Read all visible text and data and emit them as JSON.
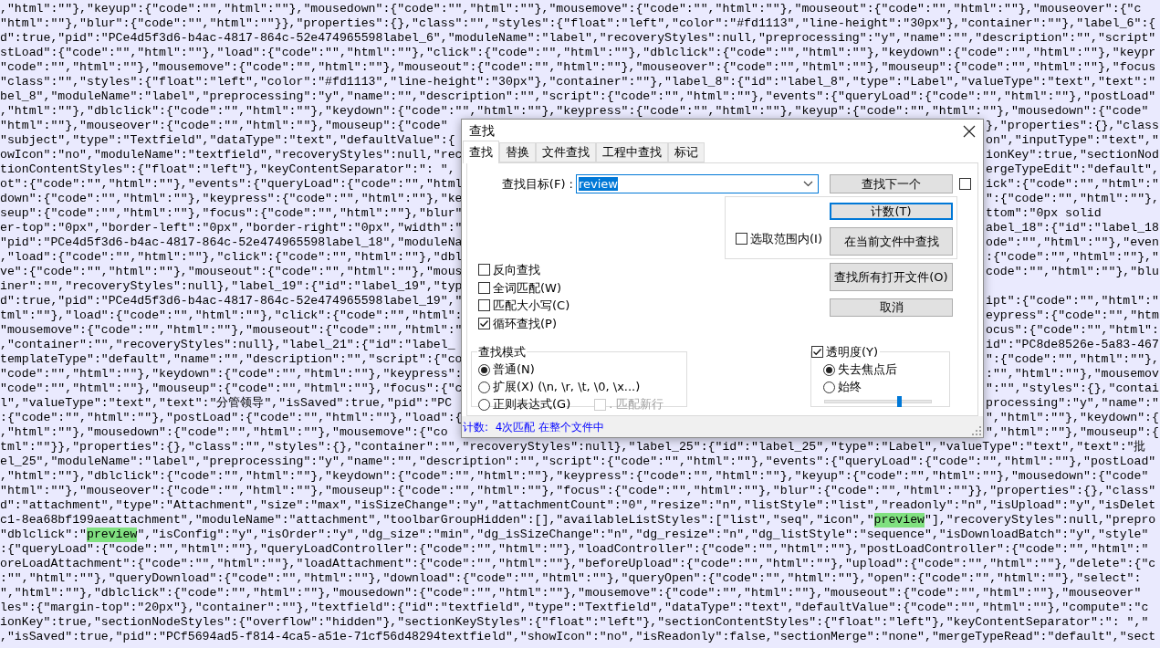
{
  "editor": {
    "lines": [
      {
        "runs": [
          {
            "text": ",\"html\":\"\"},\"keyup\":{\"code\":\"\",\"html\":\"\"},\"mousedown\":{\"code\":\"\",\"html\":\"\"},\"mousemove\":{\"code\":\"\",\"html\":\"\"},\"mouseout\":{\"code\":\"\",\"html\":\"\"},\"mouseover\":{\"c",
            "match": false
          }
        ]
      },
      {
        "runs": [
          {
            "text": "\"html\":\"\"},\"blur\":{\"code\":\"\",\"html\":\"\"}},\"properties\":{},\"class\":\"\",\"styles\":{\"float\":\"left\",\"color\":\"#fd1113\",\"line-height\":\"30px\"},\"container\":\"\"},\"label_6\":{",
            "match": false
          }
        ]
      },
      {
        "runs": [
          {
            "text": "d\":true,\"pid\":\"PCe4d5f3d6-b4ac-4817-864c-52e474965598label_6\",\"moduleName\":\"label\",\"recoveryStyles\":null,\"preprocessing\":\"y\",\"name\":\"\",\"description\":\"\",\"script\"",
            "match": false
          }
        ]
      },
      {
        "runs": [
          {
            "text": "stLoad\":{\"code\":\"\",\"html\":\"\"},\"load\":{\"code\":\"\",\"html\":\"\"},\"click\":{\"code\":\"\",\"html\":\"\"},\"dblclick\":{\"code\":\"\",\"html\":\"\"},\"keydown\":{\"code\":\"\",\"html\":\"\"},\"keypr",
            "match": false
          }
        ]
      },
      {
        "runs": [
          {
            "text": "\"code\":\"\",\"html\":\"\"},\"mousemove\":{\"code\":\"\",\"html\":\"\"},\"mouseout\":{\"code\":\"\",\"html\":\"\"},\"mouseover\":{\"code\":\"\",\"html\":\"\"},\"mouseup\":{\"code\":\"\",\"html\":\"\"},\"focus",
            "match": false
          }
        ]
      },
      {
        "runs": [
          {
            "text": "\"class\":\"\",\"styles\":{\"float\":\"left\",\"color\":\"#fd1113\",\"line-height\":\"30px\"},\"container\":\"\"},\"label_8\":{\"id\":\"label_8\",\"type\":\"Label\",\"valueType\":\"text\",\"text\":\"",
            "match": false
          }
        ]
      },
      {
        "runs": [
          {
            "text": "bel_8\",\"moduleName\":\"label\",\"preprocessing\":\"y\",\"name\":\"\",\"description\":\"\",\"script\":{\"code\":\"\",\"html\":\"\"},\"events\":{\"queryLoad\":{\"code\":\"\",\"html\":\"\"},\"postLoad\"",
            "match": false
          }
        ]
      },
      {
        "runs": [
          {
            "text": ",\"html\":\"\"},\"dblclick\":{\"code\":\"\",\"html\":\"\"},\"keydown\":{\"code\":\"\",\"html\":\"\"},\"keypress\":{\"code\":\"\",\"html\":\"\"},\"keyup\":{\"code\":\"\",\"html\":\"\"},\"mousedown\":{\"code\"",
            "match": false
          }
        ]
      },
      {
        "runs": [
          {
            "text": "\"html\":\"\"},\"mouseover\":{\"code\":\"\",\"html\":\"\"},\"mouseup\":{\"code\"",
            "match": false
          }
        ],
        "right": "},\"properties\":{},\"class"
      },
      {
        "runs": [
          {
            "text": "\"subject\",\"type\":\"Textfield\",\"dataType\":\"text\",\"defaultValue\":{",
            "match": false
          }
        ],
        "right": "on\",\"inputType\":\"text\",\""
      },
      {
        "runs": [
          {
            "text": "owIcon\":\"no\",\"moduleName\":\"textfield\",\"recoveryStyles\":null,\"rec",
            "match": false
          }
        ],
        "right": "ionKey\":true,\"sectionNod"
      },
      {
        "runs": [
          {
            "text": "tionContentStyles\":{\"float\":\"left\"},\"keyContentSeparator\":\": \",",
            "match": false
          }
        ],
        "right": "ergeTypeEdit\":\"default\","
      },
      {
        "runs": [
          {
            "text": "ot\":{\"code\":\"\",\"html\":\"\"},\"events\":{\"queryLoad\":{\"code\":\"\",\"html",
            "match": false
          }
        ],
        "right": "ick\":{\"code\":\"\",\"html\":\""
      },
      {
        "runs": [
          {
            "text": "down\":{\"code\":\"\",\"html\":\"\"},\"keypress\":{\"code\":\"\",\"html\":\"\"},\"ke",
            "match": false
          }
        ],
        "right": "\":{\"code\":\"\",\"html\":\"\"},"
      },
      {
        "runs": [
          {
            "text": "seup\":{\"code\":\"\",\"html\":\"\"},\"focus\":{\"code\":\"\",\"html\":\"\"},\"blur\"",
            "match": false
          }
        ],
        "right": "ttom\":\"0px solid"
      },
      {
        "runs": [
          {
            "text": "er-top\":\"0px\",\"border-left\":\"0px\",\"border-right\":\"0px\",\"width\":\"",
            "match": false
          }
        ],
        "right": "abel_18\":{\"id\":\"label_18"
      },
      {
        "runs": [
          {
            "text": "\"pid\":\"PCe4d5f3d6-b4ac-4817-864c-52e474965598label_18\",\"moduleNa",
            "match": false
          }
        ],
        "right": "ode\":\"\",\"html\":\"\"},\"even"
      },
      {
        "runs": [
          {
            "text": ",\"load\":{\"code\":\"\",\"html\":\"\"},\"click\":{\"code\":\"\",\"html\":\"\"},\"dbl",
            "match": false
          }
        ],
        "right": ":{\"code\":\"\",\"html\":\"\"},\""
      },
      {
        "runs": [
          {
            "text": "ve\":{\"code\":\"\",\"html\":\"\"},\"mouseout\":{\"code\":\"\",\"html\":\"\"},\"mous",
            "match": false
          }
        ],
        "right": "code\":\"\",\"html\":\"\"},\"blu"
      },
      {
        "runs": [
          {
            "text": "iner\":\"\",\"recoveryStyles\":null},\"label_19\":{\"id\":\"label_19\",\"typ",
            "match": false
          }
        ]
      },
      {
        "runs": [
          {
            "text": "d\":true,\"pid\":\"PCe4d5f3d6-b4ac-4817-864c-52e474965598label_19\",\"",
            "match": false
          }
        ],
        "right": "ipt\":{\"code\":\"\",\"html\":\""
      },
      {
        "runs": [
          {
            "text": "tml\":\"\"},\"load\":{\"code\":\"\",\"html\":\"\"},\"click\":{\"code\":\"\",\"html\":",
            "match": false
          }
        ],
        "right": "eypress\":{\"code\":\"\",\"htm"
      },
      {
        "runs": [
          {
            "text": "\"mousemove\":{\"code\":\"\",\"html\":\"\"},\"mouseout\":{\"code\":\"\",\"html\":\"",
            "match": false
          }
        ],
        "right": "ocus\":{\"code\":\"\",\"html\":"
      },
      {
        "runs": [
          {
            "text": ",\"container\":\"\",\"recoveryStyles\":null},\"label_21\":{\"id\":\"label_",
            "match": false
          }
        ],
        "right": "id\":\"PC8de8526e-5a83-467"
      },
      {
        "runs": [
          {
            "text": "templateType\":\"default\",\"name\":\"\",\"description\":\"\",\"script\":{\"co",
            "match": false
          }
        ],
        "right": "\":{\"code\":\"\",\"html\":\"\"},"
      },
      {
        "runs": [
          {
            "text": "\"code\":\"\",\"html\":\"\"},\"keydown\":{\"code\":\"\",\"html\":\"\"},\"keypress\":",
            "match": false
          }
        ],
        "right": ":\"\",\"html\":\"\"},\"mousemov"
      },
      {
        "runs": [
          {
            "text": "\"code\":\"\",\"html\":\"\"},\"mouseup\":{\"code\":\"\",\"html\":\"\"},\"focus\":{\"c",
            "match": false
          }
        ],
        "right": "\":\"\",\"styles\":{},\"contai"
      },
      {
        "runs": [
          {
            "text": "l\",\"valueType\":\"text\",\"text\":\"分管领导\",\"isSaved\":true,\"pid\":\"PC",
            "match": false
          }
        ],
        "right": "processing\":\"y\",\"name\":\""
      },
      {
        "runs": [
          {
            "text": ":{\"code\":\"\",\"html\":\"\"},\"postLoad\":{\"code\":\"\",\"html\":\"\"},\"load\":{",
            "match": false
          }
        ],
        "right": "\",\"html\":\"\"},\"keydown\":{"
      },
      {
        "runs": [
          {
            "text": ",\"html\":\"\"},\"mousedown\":{\"code\":\"\",\"html\":\"\"},\"mousemove\":{\"co",
            "match": false
          }
        ],
        "right": "\",\"html\":\"\"},\"mouseup\":{"
      },
      {
        "runs": [
          {
            "text": "tml\":\"\"}},\"properties\":{},\"class\":\"\",\"styles\":{},\"container\":\"\",\"recoveryStyles\":null},\"label_25\":{\"id\":\"label_25\",\"type\":\"Label\",\"valueType\":\"text\",\"text\":\"批",
            "match": false
          }
        ]
      },
      {
        "runs": [
          {
            "text": "el_25\",\"moduleName\":\"label\",\"preprocessing\":\"y\",\"name\":\"\",\"description\":\"\",\"script\":{\"code\":\"\",\"html\":\"\"},\"events\":{\"queryLoad\":{\"code\":\"\",\"html\":\"\"},\"postLoad\"",
            "match": false
          }
        ]
      },
      {
        "runs": [
          {
            "text": ",\"html\":\"\"},\"dblclick\":{\"code\":\"\",\"html\":\"\"},\"keydown\":{\"code\":\"\",\"html\":\"\"},\"keypress\":{\"code\":\"\",\"html\":\"\"},\"keyup\":{\"code\":\"\",\"html\":\"\"},\"mousedown\":{\"code\"",
            "match": false
          }
        ]
      },
      {
        "runs": [
          {
            "text": "\"html\":\"\"},\"mouseover\":{\"code\":\"\",\"html\":\"\"},\"mouseup\":{\"code\":\"\",\"html\":\"\"},\"focus\":{\"code\":\"\",\"html\":\"\"},\"blur\":{\"code\":\"\",\"html\":\"\"}},\"properties\":{},\"class\"",
            "match": false
          }
        ]
      },
      {
        "runs": [
          {
            "text": "d\":\"attachment\",\"type\":\"Attachment\",\"size\":\"max\",\"isSizeChange\":\"y\",\"attachmentCount\":\"0\",\"resize\":\"n\",\"listStyle\":\"list\",\"readonly\":\"n\",\"isUpload\":\"y\",\"isDelet",
            "match": false
          }
        ]
      },
      {
        "runs": [
          {
            "text": "c1-8ea68bf199aeattachment\",\"moduleName\":\"attachment\",\"toolbarGroupHidden\":[],\"availableListStyles\":[\"list\",\"seq\",\"icon\",\"",
            "match": false
          },
          {
            "text": "preview",
            "match": true
          },
          {
            "text": "\"],\"recoveryStyles\":null,\"prepro",
            "match": false
          }
        ]
      },
      {
        "runs": [
          {
            "text": "\"dblclick\":\"",
            "match": false
          },
          {
            "text": "preview",
            "match": true
          },
          {
            "text": "\",\"isConfig\":\"y\",\"isOrder\":\"y\",\"dg_size\":\"min\",\"dg_isSizeChange\":\"n\",\"dg_resize\":\"n\",\"dg_listStyle\":\"sequence\",\"isDownloadBatch\":\"y\",\"style\"",
            "match": false
          }
        ]
      },
      {
        "runs": [
          {
            "text": ":{\"queryLoad\":{\"code\":\"\",\"html\":\"\"},\"queryLoadController\":{\"code\":\"\",\"html\":\"\"},\"loadController\":{\"code\":\"\",\"html\":\"\"},\"postLoadController\":{\"code\":\"\",\"html\":\"",
            "match": false
          }
        ]
      },
      {
        "runs": [
          {
            "text": "oreLoadAttachment\":{\"code\":\"\",\"html\":\"\"},\"loadAttachment\":{\"code\":\"\",\"html\":\"\"},\"beforeUpload\":{\"code\":\"\",\"html\":\"\"},\"upload\":{\"code\":\"\",\"html\":\"\"},\"delete\":{\"c",
            "match": false
          }
        ]
      },
      {
        "runs": [
          {
            "text": ":\"\",\"html\":\"\"},\"queryDownload\":{\"code\":\"\",\"html\":\"\"},\"download\":{\"code\":\"\",\"html\":\"\"},\"queryOpen\":{\"code\":\"\",\"html\":\"\"},\"open\":{\"code\":\"\",\"html\":\"\"},\"select\":",
            "match": false
          }
        ]
      },
      {
        "runs": [
          {
            "text": "\",\"html\":\"\"},\"dblclick\":{\"code\":\"\",\"html\":\"\"},\"mousedown\":{\"code\":\"\",\"html\":\"\"},\"mousemove\":{\"code\":\"\",\"html\":\"\"},\"mouseout\":{\"code\":\"\",\"html\":\"\"},\"mouseover\"",
            "match": false
          }
        ]
      },
      {
        "runs": [
          {
            "text": "les\":{\"margin-top\":\"20px\"},\"container\":\"\"},\"textfield\":{\"id\":\"textfield\",\"type\":\"Textfield\",\"dataType\":\"text\",\"defaultValue\":{\"code\":\"\",\"html\":\"\"},\"compute\":\"c",
            "match": false
          }
        ]
      },
      {
        "runs": [
          {
            "text": "ionKey\":true,\"sectionNodeStyles\":{\"overflow\":\"hidden\"},\"sectionKeyStyles\":{\"float\":\"left\"},\"sectionContentStyles\":{\"float\":\"left\"},\"keyContentSeparator\":\": \",\"",
            "match": false
          }
        ]
      },
      {
        "runs": [
          {
            "text": ",\"isSaved\":true,\"pid\":\"PCf5694ad5-f814-4ca5-a51e-71cf56d48294textfield\",\"showIcon\":\"no\",\"isReadonly\":false,\"sectionMerge\":\"none\",\"mergeTypeRead\":\"default\",\"sect",
            "match": false
          }
        ]
      }
    ]
  },
  "find_dialog": {
    "title": "查找",
    "tabs": [
      {
        "label": "查找",
        "selected": true
      },
      {
        "label": "替换",
        "selected": false
      },
      {
        "label": "文件查找",
        "selected": false
      },
      {
        "label": "工程中查找",
        "selected": false
      },
      {
        "label": "标记",
        "selected": false
      }
    ],
    "find_what": {
      "label": "查找目标(F) :",
      "value": "review",
      "value_selected": true
    },
    "buttons": [
      {
        "label": "查找下一个",
        "focused": false
      },
      {
        "label": "计数(T)",
        "focused": true
      },
      {
        "label": "在当前文件中查找",
        "focused": false
      },
      {
        "label": "查找所有打开文件(O)",
        "focused": false
      },
      {
        "label": "取消",
        "focused": false
      }
    ],
    "side_checkbox": {
      "checked": false
    },
    "in_selection": {
      "label": "选取范围内(I)",
      "checked": false
    },
    "options": [
      {
        "label": "反向查找",
        "checked": false
      },
      {
        "label": "全词匹配(W)",
        "checked": false
      },
      {
        "label": "匹配大小写(C)",
        "checked": false
      },
      {
        "label": "循环查找(P)",
        "checked": true
      }
    ],
    "search_mode": {
      "title": "查找模式",
      "options": [
        {
          "label": "普通(N)",
          "selected": true
        },
        {
          "label": "扩展(X) (\\n, \\r, \\t, \\0, \\x...)",
          "selected": false
        },
        {
          "label": "正则表达式(G)",
          "selected": false
        }
      ],
      "match_newline": {
        "label": ". 匹配新行",
        "checked": false,
        "disabled": true
      }
    },
    "transparency": {
      "label": "透明度(Y)",
      "checked": true,
      "options": [
        {
          "label": "失去焦点后",
          "selected": true
        },
        {
          "label": "始终",
          "selected": false
        }
      ],
      "level": 0.7
    },
    "status": "计数:  4次匹配 在整个文件中"
  }
}
